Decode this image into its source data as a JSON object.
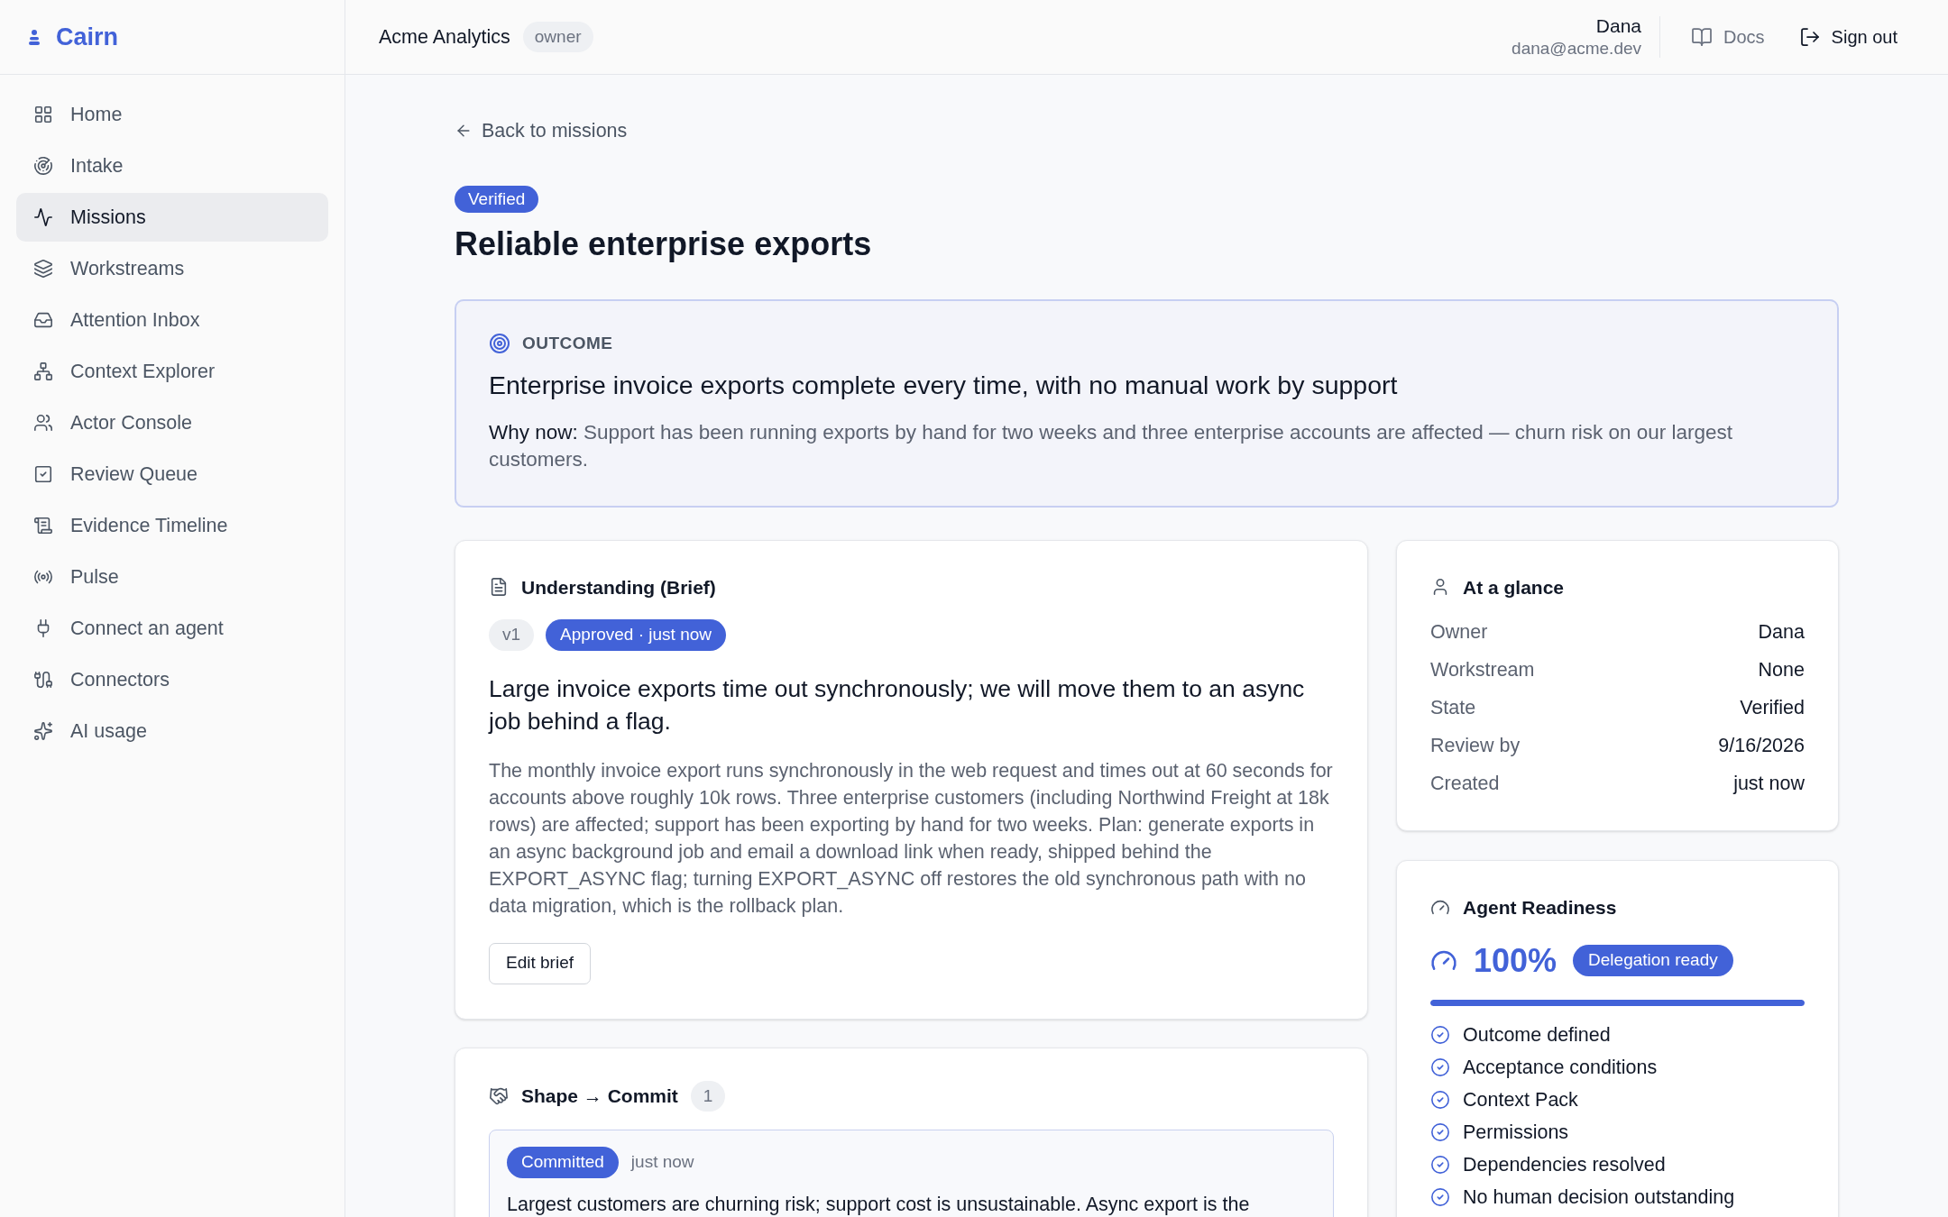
{
  "sidebar": {
    "brand": "Cairn",
    "items": [
      {
        "label": "Home",
        "selected": false
      },
      {
        "label": "Intake",
        "selected": false
      },
      {
        "label": "Missions",
        "selected": true
      },
      {
        "label": "Workstreams",
        "selected": false
      },
      {
        "label": "Attention Inbox",
        "selected": false
      },
      {
        "label": "Context Explorer",
        "selected": false
      },
      {
        "label": "Actor Console",
        "selected": false
      },
      {
        "label": "Review Queue",
        "selected": false
      },
      {
        "label": "Evidence Timeline",
        "selected": false
      },
      {
        "label": "Pulse",
        "selected": false
      },
      {
        "label": "Connect an agent",
        "selected": false
      },
      {
        "label": "Connectors",
        "selected": false
      },
      {
        "label": "AI usage",
        "selected": false
      }
    ]
  },
  "header": {
    "organization": "Acme Analytics",
    "role_badge": "owner",
    "user": {
      "name": "Dana",
      "email": "dana@acme.dev"
    },
    "links": [
      {
        "label": "Docs",
        "kind": "link"
      },
      {
        "label": "Sign out",
        "kind": "button"
      }
    ]
  },
  "mission": {
    "back_link": "Back to missions",
    "status_badge": "Verified",
    "title": "Reliable enterprise exports",
    "outcome": {
      "heading": "OUTCOME",
      "statement": "Enterprise invoice exports complete every time, with no manual work by support",
      "why_now_label": "Why now:",
      "why_now": "Support has been running exports by hand for two weeks and three enterprise accounts are affected — churn risk on our largest customers."
    }
  },
  "understanding": {
    "title": "Understanding (Brief)",
    "version": "v1",
    "approval": "Approved · just now",
    "summary": "Large invoice exports time out synchronously; we will move them to an async job behind a flag.",
    "detail": "The monthly invoice export runs synchronously in the web request and times out at 60 seconds for accounts above roughly 10k rows. Three enterprise customers (including Northwind Freight at 18k rows) are affected; support has been exporting by hand for two weeks. Plan: generate exports in an async background job and email a download link when ready, shipped behind the EXPORT_ASYNC flag; turning EXPORT_ASYNC off restores the old synchronous path with no data migration, which is the rollback plan.",
    "edit_button": "Edit brief"
  },
  "at_a_glance": {
    "title": "At a glance",
    "rows": [
      {
        "label": "Owner",
        "value": "Dana"
      },
      {
        "label": "Workstream",
        "value": "None"
      },
      {
        "label": "State",
        "value": "Verified"
      },
      {
        "label": "Review by",
        "value": "9/16/2026"
      },
      {
        "label": "Created",
        "value": "just now"
      }
    ]
  },
  "agent_readiness": {
    "title": "Agent Readiness",
    "score": "100%",
    "badge": "Delegation ready",
    "level": 1,
    "checklist": [
      {
        "label": "Outcome defined",
        "checked": true
      },
      {
        "label": "Acceptance conditions",
        "checked": true
      },
      {
        "label": "Context Pack",
        "checked": true
      },
      {
        "label": "Permissions",
        "checked": true
      },
      {
        "label": "Dependencies resolved",
        "checked": true
      },
      {
        "label": "No human decision outstanding",
        "checked": true
      }
    ]
  },
  "shape_commit": {
    "title": "Shape → Commit",
    "count": "1",
    "entries": [
      {
        "status": "Committed",
        "time": "just now",
        "text": "Largest customers are churning risk; support cost is unsustainable. Async export is the"
      }
    ]
  }
}
